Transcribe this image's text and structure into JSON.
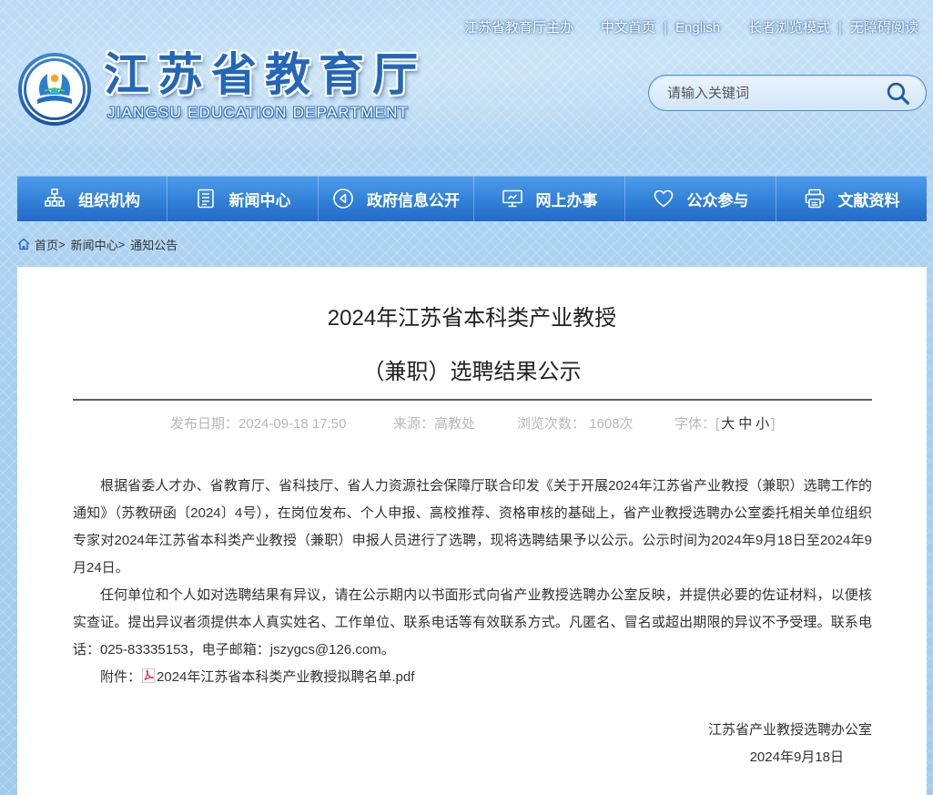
{
  "header": {
    "top_links": {
      "sponsor": "江苏省教育厅主办",
      "home": "中文首页",
      "english": "English",
      "elder_mode": "长者浏览模式",
      "accessible_reading": "无障碍阅读",
      "separator": "|"
    },
    "logo_icon": "jiangsu-education-emblem-icon",
    "site_title": "江苏省教育厅",
    "site_subtitle": "JIANGSU EDUCATION DEPARTMENT",
    "search": {
      "placeholder": "请输入关键词",
      "icon": "search-icon"
    }
  },
  "nav": {
    "items": [
      {
        "label": "组织机构",
        "icon": "org-chart-icon"
      },
      {
        "label": "新闻中心",
        "icon": "news-document-icon"
      },
      {
        "label": "政府信息公开",
        "icon": "info-disclosure-icon"
      },
      {
        "label": "网上办事",
        "icon": "monitor-icon"
      },
      {
        "label": "公众参与",
        "icon": "heart-icon"
      },
      {
        "label": "文献资料",
        "icon": "document-stack-icon"
      }
    ]
  },
  "breadcrumb": {
    "icon": "home-icon",
    "separator": ">",
    "items": [
      "首页",
      "新闻中心",
      "通知公告"
    ]
  },
  "article": {
    "title_line1": "2024年江苏省本科类产业教授",
    "title_line2": "（兼职）选聘结果公示",
    "meta": {
      "date_label": "发布日期：",
      "date": "2024-09-18 17:50",
      "source_label": "来源：",
      "source": "高教处",
      "views_label": "浏览次数：",
      "views": "1608次",
      "font_label": "字体：",
      "bracket_open": "[",
      "font_large": "大",
      "font_medium": "中",
      "font_small": "小",
      "bracket_close": "]"
    },
    "paragraphs": [
      "根据省委人才办、省教育厅、省科技厅、省人力资源社会保障厅联合印发《关于开展2024年江苏省产业教授（兼职）选聘工作的通知》（苏教研函〔2024〕4号），在岗位发布、个人申报、高校推荐、资格审核的基础上，省产业教授选聘办公室委托相关单位组织专家对2024年江苏省本科类产业教授（兼职）申报人员进行了选聘，现将选聘结果予以公示。公示时间为2024年9月18日至2024年9月24日。",
      "任何单位和个人如对选聘结果有异议，请在公示期内以书面形式向省产业教授选聘办公室反映，并提供必要的佐证材料，以便核实查证。提出异议者须提供本人真实姓名、工作单位、联系电话等有效联系方式。凡匿名、冒名或超出期限的异议不予受理。联系电话：025-83335153，电子邮箱：jszygcs@126.com。"
    ],
    "attachment": {
      "label": "附件：",
      "icon": "pdf-file-icon",
      "file_name": "2024年江苏省本科类产业教授拟聘名单.pdf"
    },
    "signature": {
      "org": "江苏省产业教授选聘办公室",
      "date": "2024年9月18日"
    }
  },
  "colors": {
    "page_bg": "#aed2f0",
    "nav_top": "#4e9bea",
    "nav_bottom": "#226bc6",
    "site_title_blue": "#2466b8",
    "meta_gray": "#b8b8b8",
    "body_text": "#333333",
    "pdf_red": "#d8262b"
  }
}
